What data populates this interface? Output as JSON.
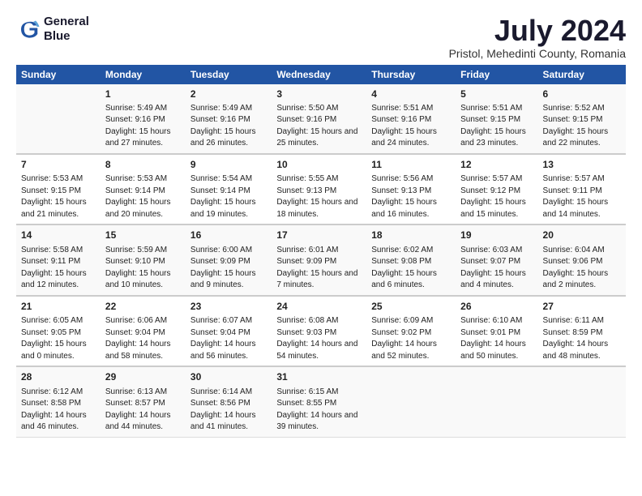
{
  "logo": {
    "line1": "General",
    "line2": "Blue"
  },
  "title": "July 2024",
  "subtitle": "Pristol, Mehedinti County, Romania",
  "days_of_week": [
    "Sunday",
    "Monday",
    "Tuesday",
    "Wednesday",
    "Thursday",
    "Friday",
    "Saturday"
  ],
  "weeks": [
    [
      {
        "day": "",
        "data": ""
      },
      {
        "day": "1",
        "sunrise": "Sunrise: 5:49 AM",
        "sunset": "Sunset: 9:16 PM",
        "daylight": "Daylight: 15 hours and 27 minutes."
      },
      {
        "day": "2",
        "sunrise": "Sunrise: 5:49 AM",
        "sunset": "Sunset: 9:16 PM",
        "daylight": "Daylight: 15 hours and 26 minutes."
      },
      {
        "day": "3",
        "sunrise": "Sunrise: 5:50 AM",
        "sunset": "Sunset: 9:16 PM",
        "daylight": "Daylight: 15 hours and 25 minutes."
      },
      {
        "day": "4",
        "sunrise": "Sunrise: 5:51 AM",
        "sunset": "Sunset: 9:16 PM",
        "daylight": "Daylight: 15 hours and 24 minutes."
      },
      {
        "day": "5",
        "sunrise": "Sunrise: 5:51 AM",
        "sunset": "Sunset: 9:15 PM",
        "daylight": "Daylight: 15 hours and 23 minutes."
      },
      {
        "day": "6",
        "sunrise": "Sunrise: 5:52 AM",
        "sunset": "Sunset: 9:15 PM",
        "daylight": "Daylight: 15 hours and 22 minutes."
      }
    ],
    [
      {
        "day": "7",
        "sunrise": "Sunrise: 5:53 AM",
        "sunset": "Sunset: 9:15 PM",
        "daylight": "Daylight: 15 hours and 21 minutes."
      },
      {
        "day": "8",
        "sunrise": "Sunrise: 5:53 AM",
        "sunset": "Sunset: 9:14 PM",
        "daylight": "Daylight: 15 hours and 20 minutes."
      },
      {
        "day": "9",
        "sunrise": "Sunrise: 5:54 AM",
        "sunset": "Sunset: 9:14 PM",
        "daylight": "Daylight: 15 hours and 19 minutes."
      },
      {
        "day": "10",
        "sunrise": "Sunrise: 5:55 AM",
        "sunset": "Sunset: 9:13 PM",
        "daylight": "Daylight: 15 hours and 18 minutes."
      },
      {
        "day": "11",
        "sunrise": "Sunrise: 5:56 AM",
        "sunset": "Sunset: 9:13 PM",
        "daylight": "Daylight: 15 hours and 16 minutes."
      },
      {
        "day": "12",
        "sunrise": "Sunrise: 5:57 AM",
        "sunset": "Sunset: 9:12 PM",
        "daylight": "Daylight: 15 hours and 15 minutes."
      },
      {
        "day": "13",
        "sunrise": "Sunrise: 5:57 AM",
        "sunset": "Sunset: 9:11 PM",
        "daylight": "Daylight: 15 hours and 14 minutes."
      }
    ],
    [
      {
        "day": "14",
        "sunrise": "Sunrise: 5:58 AM",
        "sunset": "Sunset: 9:11 PM",
        "daylight": "Daylight: 15 hours and 12 minutes."
      },
      {
        "day": "15",
        "sunrise": "Sunrise: 5:59 AM",
        "sunset": "Sunset: 9:10 PM",
        "daylight": "Daylight: 15 hours and 10 minutes."
      },
      {
        "day": "16",
        "sunrise": "Sunrise: 6:00 AM",
        "sunset": "Sunset: 9:09 PM",
        "daylight": "Daylight: 15 hours and 9 minutes."
      },
      {
        "day": "17",
        "sunrise": "Sunrise: 6:01 AM",
        "sunset": "Sunset: 9:09 PM",
        "daylight": "Daylight: 15 hours and 7 minutes."
      },
      {
        "day": "18",
        "sunrise": "Sunrise: 6:02 AM",
        "sunset": "Sunset: 9:08 PM",
        "daylight": "Daylight: 15 hours and 6 minutes."
      },
      {
        "day": "19",
        "sunrise": "Sunrise: 6:03 AM",
        "sunset": "Sunset: 9:07 PM",
        "daylight": "Daylight: 15 hours and 4 minutes."
      },
      {
        "day": "20",
        "sunrise": "Sunrise: 6:04 AM",
        "sunset": "Sunset: 9:06 PM",
        "daylight": "Daylight: 15 hours and 2 minutes."
      }
    ],
    [
      {
        "day": "21",
        "sunrise": "Sunrise: 6:05 AM",
        "sunset": "Sunset: 9:05 PM",
        "daylight": "Daylight: 15 hours and 0 minutes."
      },
      {
        "day": "22",
        "sunrise": "Sunrise: 6:06 AM",
        "sunset": "Sunset: 9:04 PM",
        "daylight": "Daylight: 14 hours and 58 minutes."
      },
      {
        "day": "23",
        "sunrise": "Sunrise: 6:07 AM",
        "sunset": "Sunset: 9:04 PM",
        "daylight": "Daylight: 14 hours and 56 minutes."
      },
      {
        "day": "24",
        "sunrise": "Sunrise: 6:08 AM",
        "sunset": "Sunset: 9:03 PM",
        "daylight": "Daylight: 14 hours and 54 minutes."
      },
      {
        "day": "25",
        "sunrise": "Sunrise: 6:09 AM",
        "sunset": "Sunset: 9:02 PM",
        "daylight": "Daylight: 14 hours and 52 minutes."
      },
      {
        "day": "26",
        "sunrise": "Sunrise: 6:10 AM",
        "sunset": "Sunset: 9:01 PM",
        "daylight": "Daylight: 14 hours and 50 minutes."
      },
      {
        "day": "27",
        "sunrise": "Sunrise: 6:11 AM",
        "sunset": "Sunset: 8:59 PM",
        "daylight": "Daylight: 14 hours and 48 minutes."
      }
    ],
    [
      {
        "day": "28",
        "sunrise": "Sunrise: 6:12 AM",
        "sunset": "Sunset: 8:58 PM",
        "daylight": "Daylight: 14 hours and 46 minutes."
      },
      {
        "day": "29",
        "sunrise": "Sunrise: 6:13 AM",
        "sunset": "Sunset: 8:57 PM",
        "daylight": "Daylight: 14 hours and 44 minutes."
      },
      {
        "day": "30",
        "sunrise": "Sunrise: 6:14 AM",
        "sunset": "Sunset: 8:56 PM",
        "daylight": "Daylight: 14 hours and 41 minutes."
      },
      {
        "day": "31",
        "sunrise": "Sunrise: 6:15 AM",
        "sunset": "Sunset: 8:55 PM",
        "daylight": "Daylight: 14 hours and 39 minutes."
      },
      {
        "day": "",
        "data": ""
      },
      {
        "day": "",
        "data": ""
      },
      {
        "day": "",
        "data": ""
      }
    ]
  ]
}
